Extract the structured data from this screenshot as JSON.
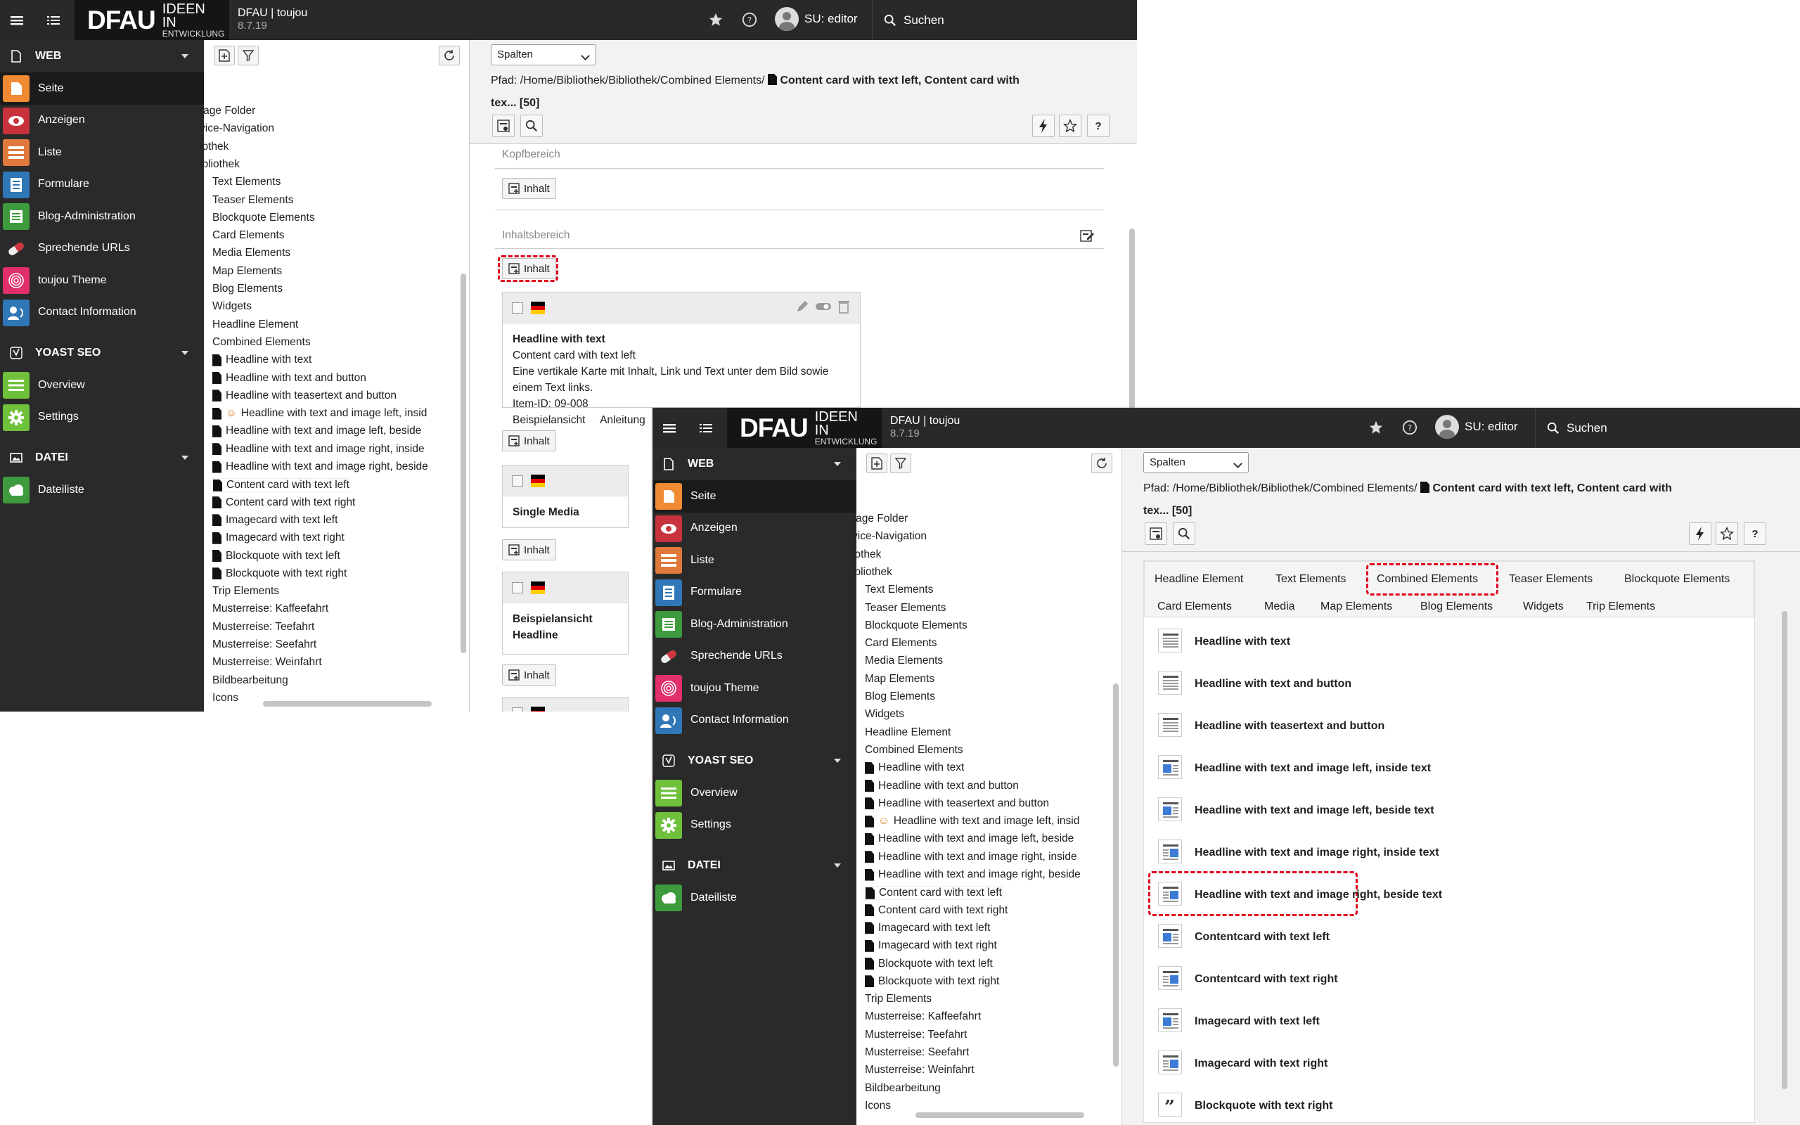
{
  "header": {
    "logo_main": "DFAU",
    "logo_line1": "IDEEN IN",
    "logo_line2": "ENTWICKLUNG",
    "site_name": "DFAU | toujou",
    "version": "8.7.19",
    "user": "SU: editor",
    "search": "Suchen"
  },
  "nav": {
    "web": {
      "title": "WEB",
      "items": [
        {
          "label": "Seite",
          "color": "#f08a33"
        },
        {
          "label": "Anzeigen",
          "color": "#c8323c"
        },
        {
          "label": "Liste",
          "color": "#e07a3c"
        },
        {
          "label": "Formulare",
          "color": "#2f77b7"
        },
        {
          "label": "Blog-Administration",
          "color": "#3d9b3d"
        },
        {
          "label": "Sprechende URLs",
          "color": "#333"
        },
        {
          "label": "toujou Theme",
          "color": "#e02f6b"
        },
        {
          "label": "Contact Information",
          "color": "#2f77b7"
        }
      ]
    },
    "yoast": {
      "title": "YOAST SEO",
      "items": [
        {
          "label": "Overview",
          "color": "#6fc13c"
        },
        {
          "label": "Settings",
          "color": "#6fc13c"
        }
      ]
    },
    "datei": {
      "title": "DATEI",
      "items": [
        {
          "label": "Dateiliste",
          "color": "#3d9b3d"
        }
      ]
    }
  },
  "tree": {
    "items": [
      "rage Folder",
      "vice-Navigation",
      "iothek",
      "ibliothek",
      "Text Elements",
      "Teaser Elements",
      "Blockquote Elements",
      "Card Elements",
      "Media Elements",
      "Map Elements",
      "Blog Elements",
      "Widgets",
      "Headline Element",
      "Combined Elements",
      "Headline with text",
      "Headline with text and button",
      "Headline with teasertext and button",
      "Headline with text and image left, insid",
      "Headline with text and image left, beside",
      "Headline with text and image right, inside",
      "Headline with text and image right, beside",
      "Content card with text left",
      "Content card with text right",
      "Imagecard with text left",
      "Imagecard with text right",
      "Blockquote with text left",
      "Blockquote with text right",
      "Trip Elements",
      "Musterreise: Kaffeefahrt",
      "Musterreise: Teefahrt",
      "Musterreise: Seefahrt",
      "Musterreise: Weinfahrt",
      "Bildbearbeitung",
      "Icons"
    ]
  },
  "doc": {
    "select": "Spalten",
    "path_prefix": "Pfad: /Home/Bibliothek/Bibliothek/Combined Elements/",
    "path_title": "Content card with text left, Content card with",
    "path_title2": "tex... [50]",
    "zone1": "Kopfbereich",
    "zone2": "Inhaltsbereich",
    "new_content": "Inhalt",
    "card1": {
      "title": "Headline with text",
      "lines": [
        "Content card with text left",
        "Eine vertikale Karte mit Inhalt, Link und Text unter dem Bild sowie einem Text links.",
        "Item-ID: 09-008"
      ],
      "tail": "Beispielansicht     Anleitung     Verhalten"
    },
    "card2": {
      "title": "Single Media"
    },
    "card3": {
      "title": "Beispielansicht",
      "title2": "Headline"
    }
  },
  "wizard": {
    "tabs_row1": [
      "Headline Element",
      "Text Elements",
      "Combined Elements",
      "Teaser Elements",
      "Blockquote Elements"
    ],
    "tabs_row2": [
      "Card Elements",
      "Media",
      "Map Elements",
      "Blog Elements",
      "Widgets",
      "Trip Elements"
    ],
    "items": [
      "Headline with text",
      "Headline with text and button",
      "Headline with teasertext and button",
      "Headline with text and image left, inside text",
      "Headline with text and image left, beside text",
      "Headline with text and image right, inside text",
      "Headline with text and image right, beside text",
      "Contentcard with text left",
      "Contentcard with text right",
      "Imagecard with text left",
      "Imagecard with text right",
      "Blockquote with text right"
    ]
  },
  "colors": {
    "accent": "#f08a33",
    "highlight": "#e0001a"
  }
}
